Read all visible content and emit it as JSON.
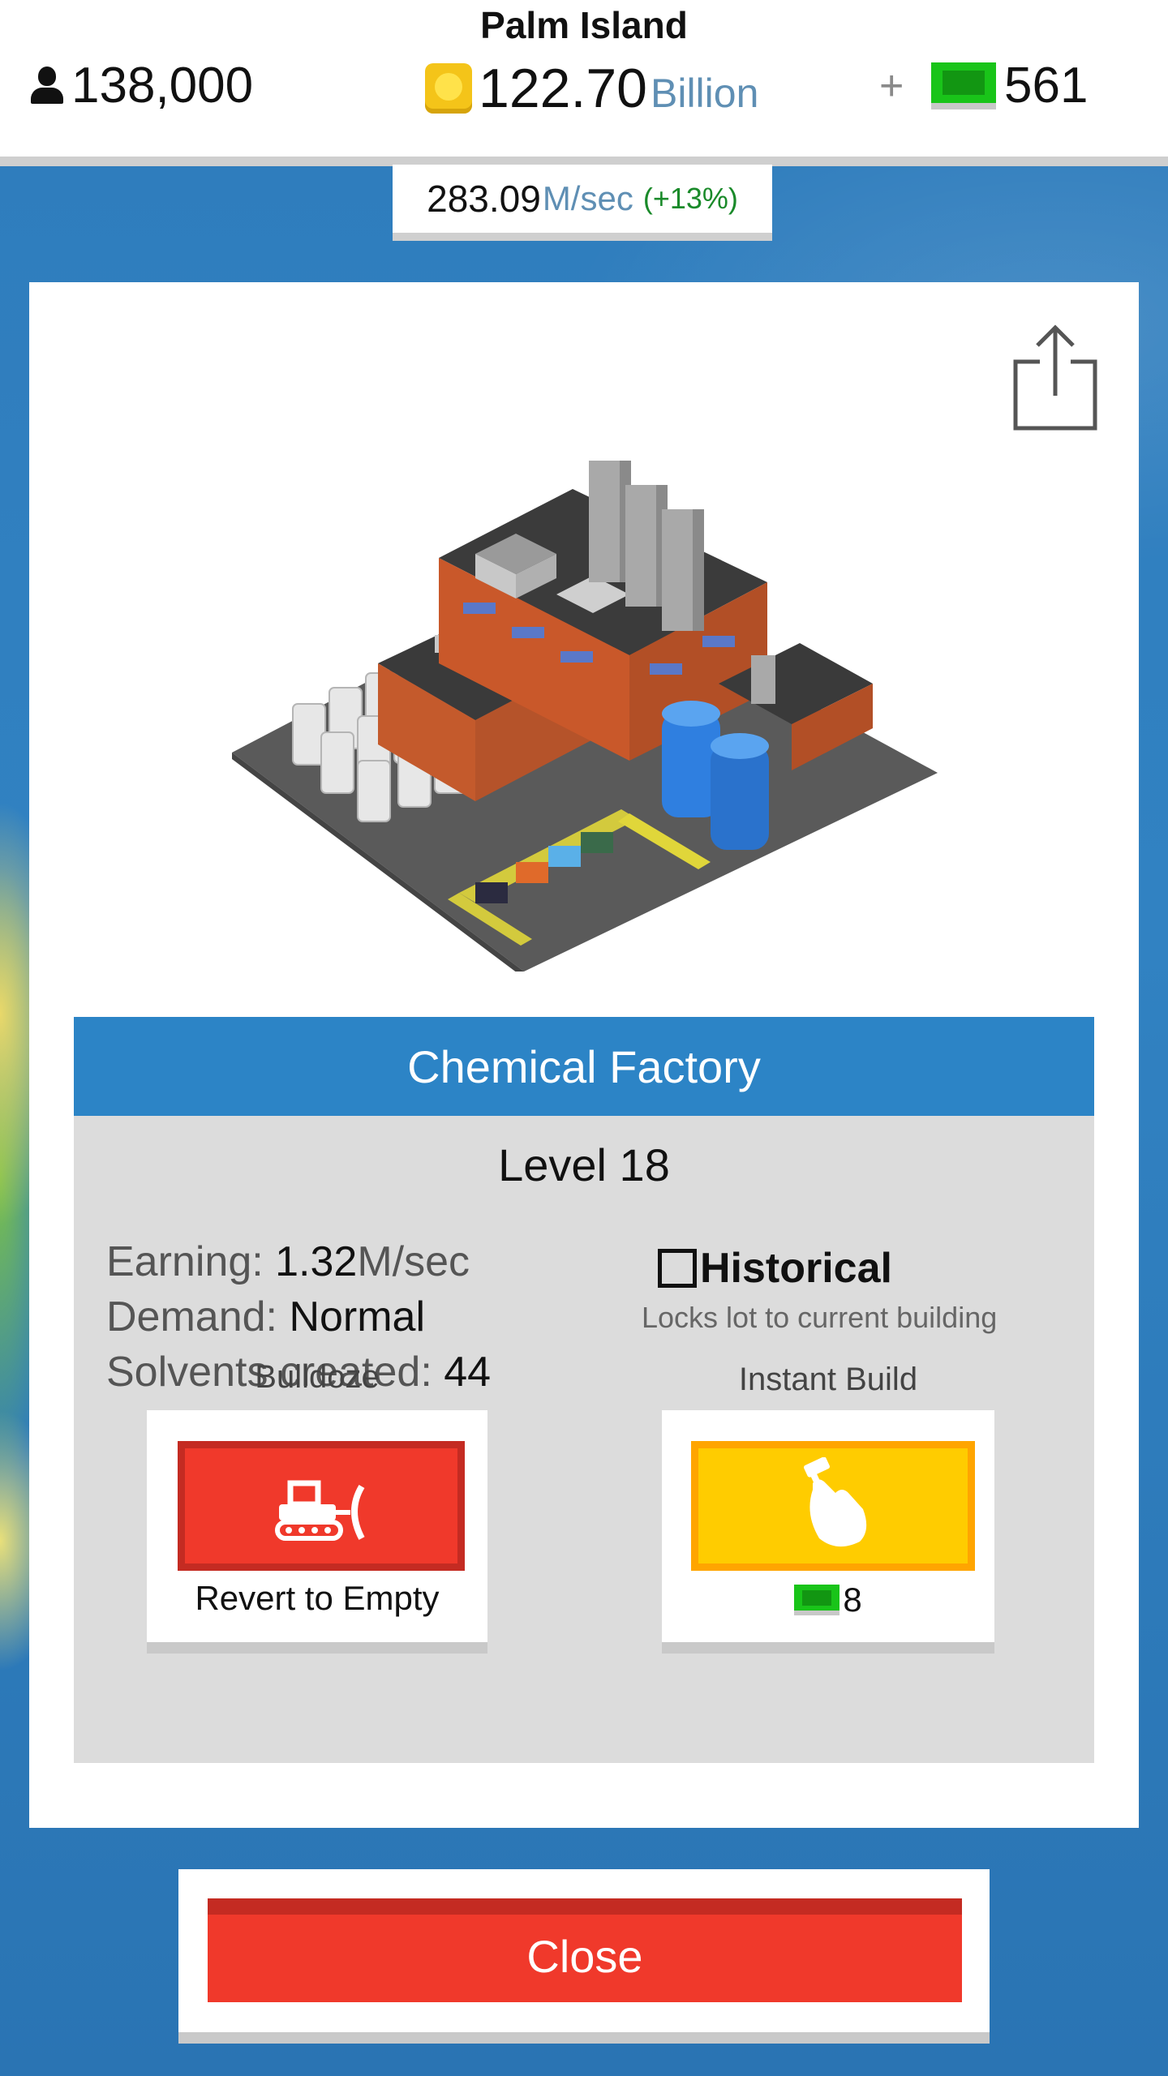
{
  "header": {
    "island_name": "Palm Island",
    "population": "138,000",
    "money_value": "122.70",
    "money_unit": "Billion",
    "plus_symbol": "+",
    "cash_value": "561",
    "rate_value": "283.09",
    "rate_unit": "M/sec",
    "rate_boost": "(+13%)"
  },
  "building": {
    "name": "Chemical Factory",
    "level": "Level 18",
    "earning_label": "Earning:",
    "earning_value": "1.32",
    "earning_unit": "M/sec",
    "demand_label": "Demand:",
    "demand_value": "Normal",
    "created_label": "Solvents created:",
    "created_value": "44"
  },
  "historical": {
    "label": "Historical",
    "description": "Locks lot to current building",
    "checked": false
  },
  "actions": {
    "bulldoze_title": "Bulldoze",
    "bulldoze_button_label": "Revert to Empty",
    "instant_title": "Instant Build",
    "instant_cost": "8"
  },
  "footer": {
    "close_label": "Close"
  },
  "icons": {
    "population": "person-icon",
    "money": "coin-icon",
    "cash": "cash-icon",
    "share": "share-icon",
    "bulldoze": "bulldozer-icon",
    "instant": "hammer-hand-icon"
  },
  "colors": {
    "header_blue": "#2c84c6",
    "bulldoze_red": "#f0392b",
    "instant_yellow": "#ffcc00",
    "cash_green": "#19c419",
    "boost_green": "#1a8a2a"
  }
}
